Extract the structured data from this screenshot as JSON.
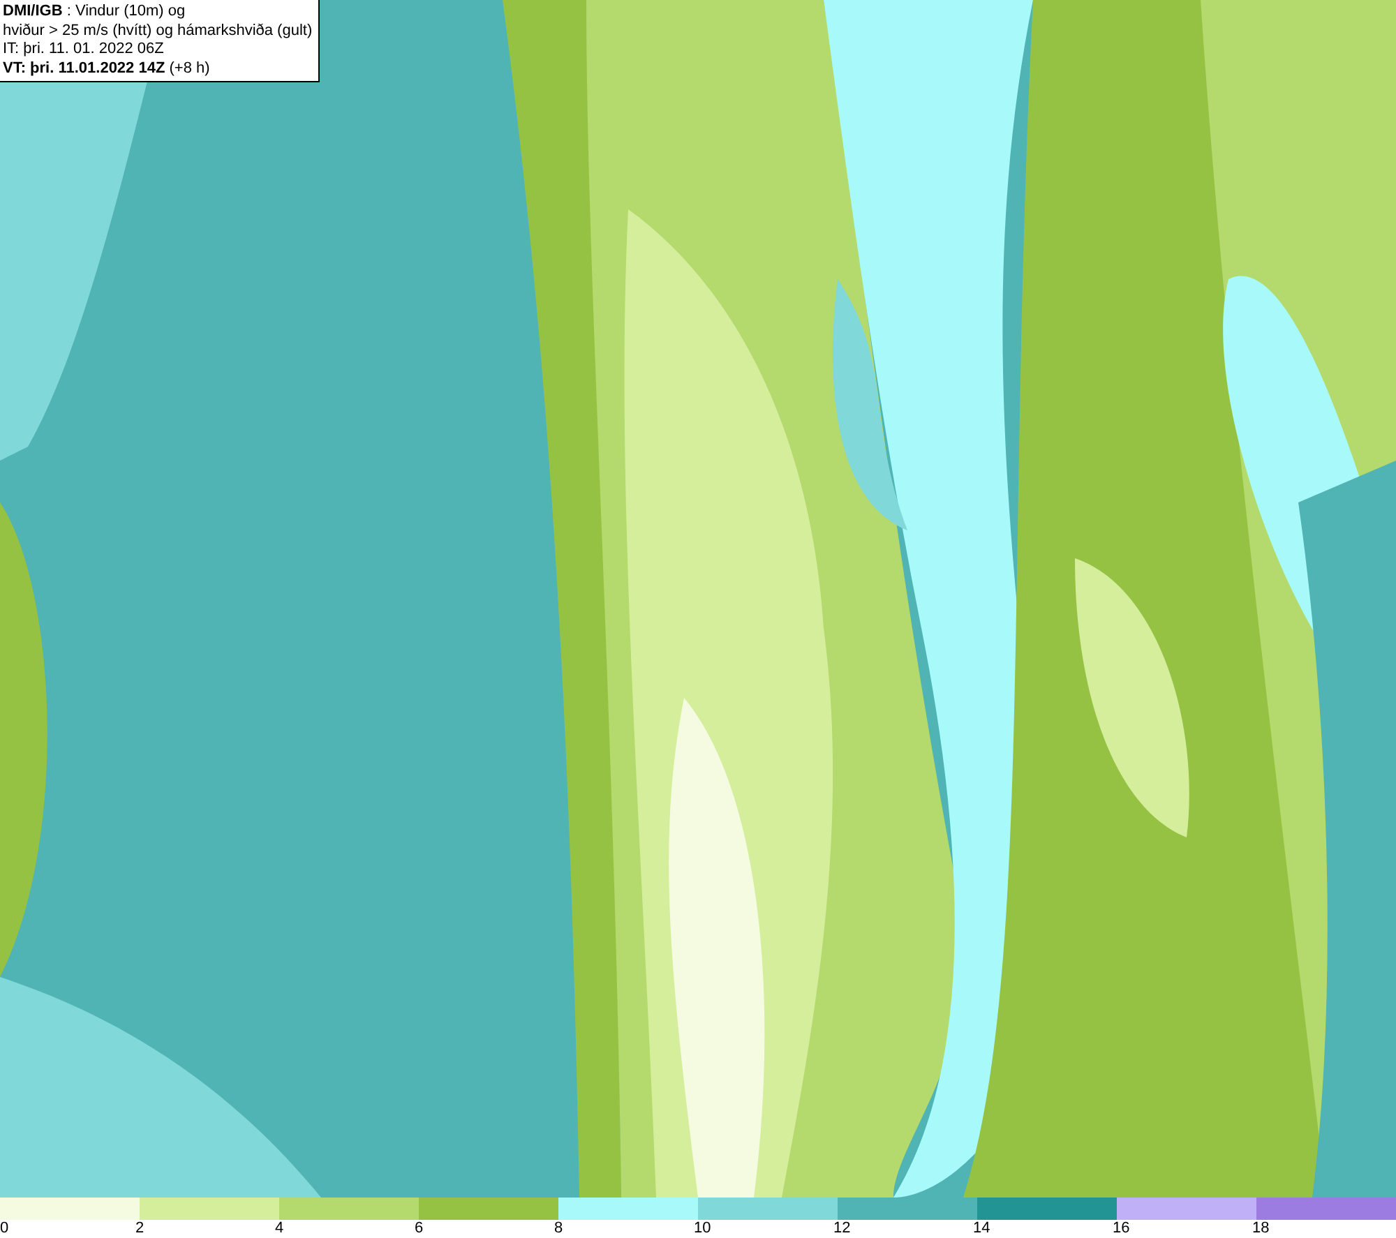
{
  "info_box": {
    "lines": [
      "**DMI/IGB** : Vindur (10m) og",
      "hviður > 25 m/s (hvítt) og hámarkshviða (gult)",
      "IT: þri. 11. 01. 2022 06Z",
      "**VT: þri. 11.01.2022 14Z** (+8 h)"
    ]
  },
  "legend": [
    {
      "label": "0",
      "color": "#f5fbe0"
    },
    {
      "label": "2",
      "color": "#d4ee9c"
    },
    {
      "label": "4",
      "color": "#b4d96c"
    },
    {
      "label": "6",
      "color": "#96c244"
    },
    {
      "label": "8",
      "color": "#a8fafa"
    },
    {
      "label": "10",
      "color": "#80d8d8"
    },
    {
      "label": "12",
      "color": "#50b4b4"
    },
    {
      "label": "14",
      "color": "#239494"
    },
    {
      "label": "16",
      "color": "#c0b0f8"
    },
    {
      "label": "18",
      "color": "#9c7ce0"
    }
  ]
}
